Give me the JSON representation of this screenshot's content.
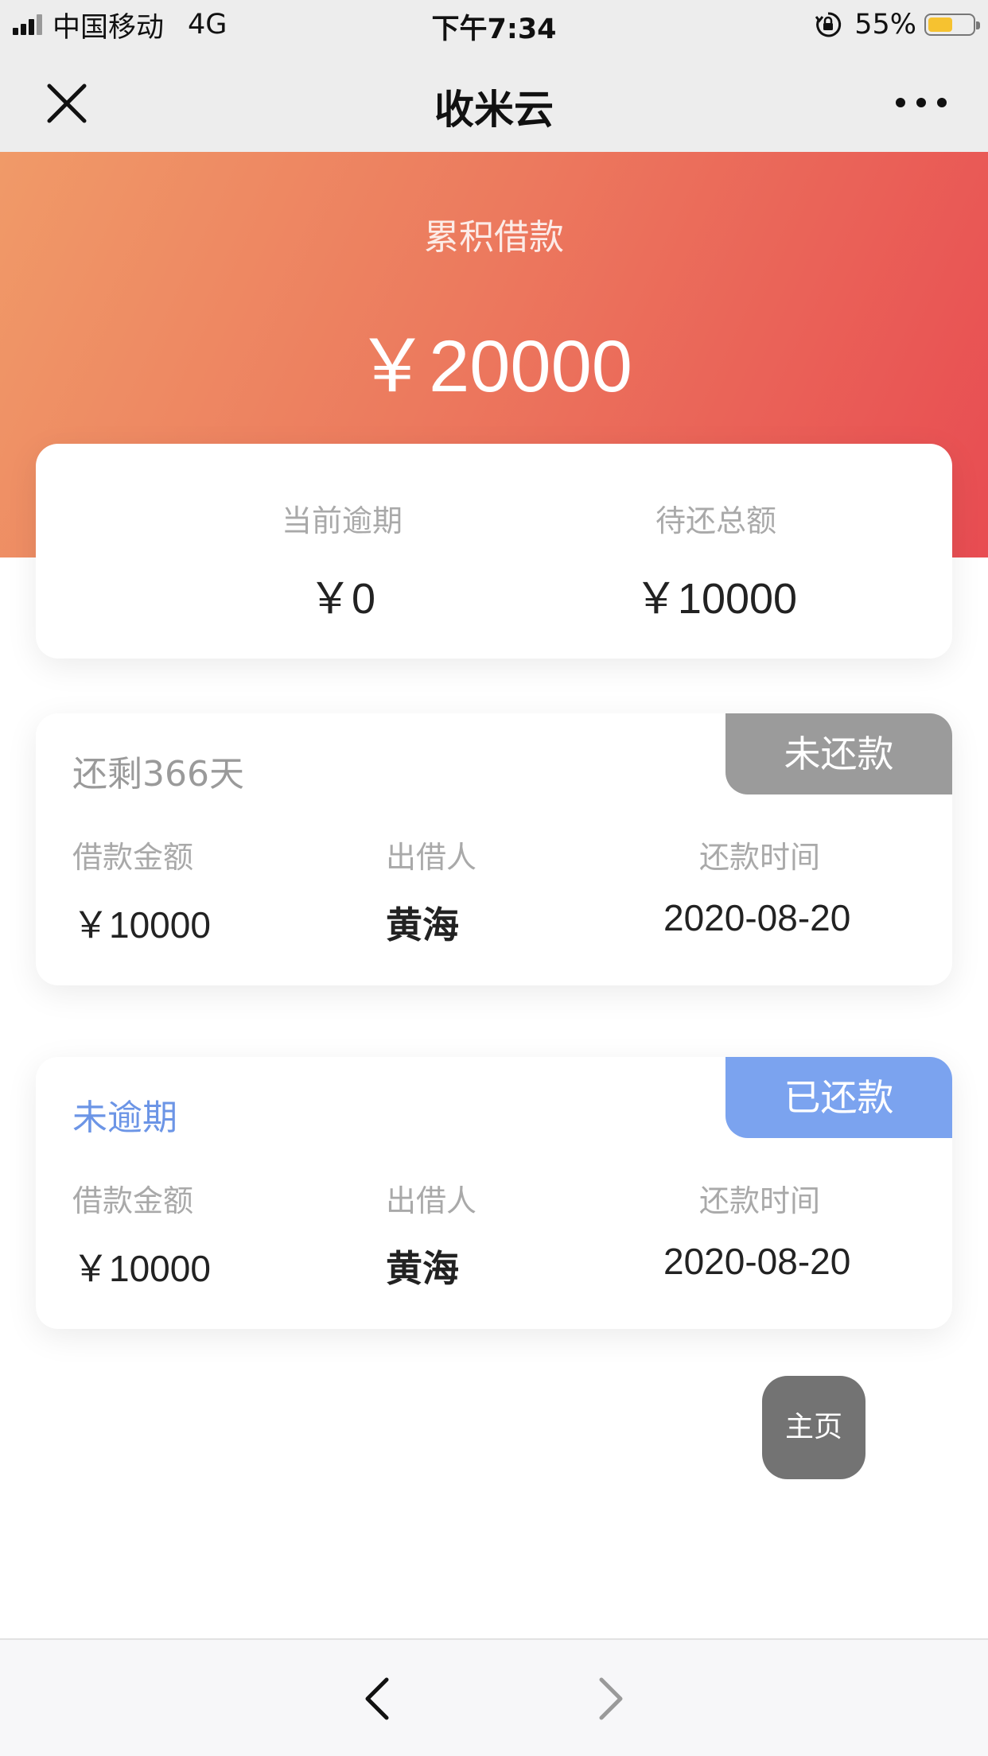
{
  "status_bar": {
    "carrier": "中国移动",
    "network": "4G",
    "time": "下午7:34",
    "battery": "55%",
    "battery_level": 0.55
  },
  "nav": {
    "title": "收米云",
    "close_icon": "close-icon",
    "more_icon": "more-icon"
  },
  "hero": {
    "label": "累积借款",
    "amount": "￥20000"
  },
  "summary": {
    "overdue_label": "当前逾期",
    "overdue_value": "￥0",
    "pending_label": "待还总额",
    "pending_value": "￥10000"
  },
  "loans": [
    {
      "status": "还剩366天",
      "badge": "未还款",
      "amount_label": "借款金额",
      "amount": "￥10000",
      "lender_label": "出借人",
      "lender": "黄海",
      "date_label": "还款时间",
      "date": "2020-08-20",
      "badge_color": "#9b9b9b"
    },
    {
      "status": "未逾期",
      "badge": "已还款",
      "amount_label": "借款金额",
      "amount": "￥10000",
      "lender_label": "出借人",
      "lender": "黄海",
      "date_label": "还款时间",
      "date": "2020-08-20",
      "badge_color": "#7ba3ef"
    }
  ],
  "home_button": "主页",
  "toolbar": {
    "back_icon": "chevron-left-icon",
    "forward_icon": "chevron-right-icon"
  },
  "colors": {
    "hero_gradient_start": "#f09a68",
    "hero_gradient_end": "#e84c52",
    "blue_accent": "#6c95e6"
  }
}
